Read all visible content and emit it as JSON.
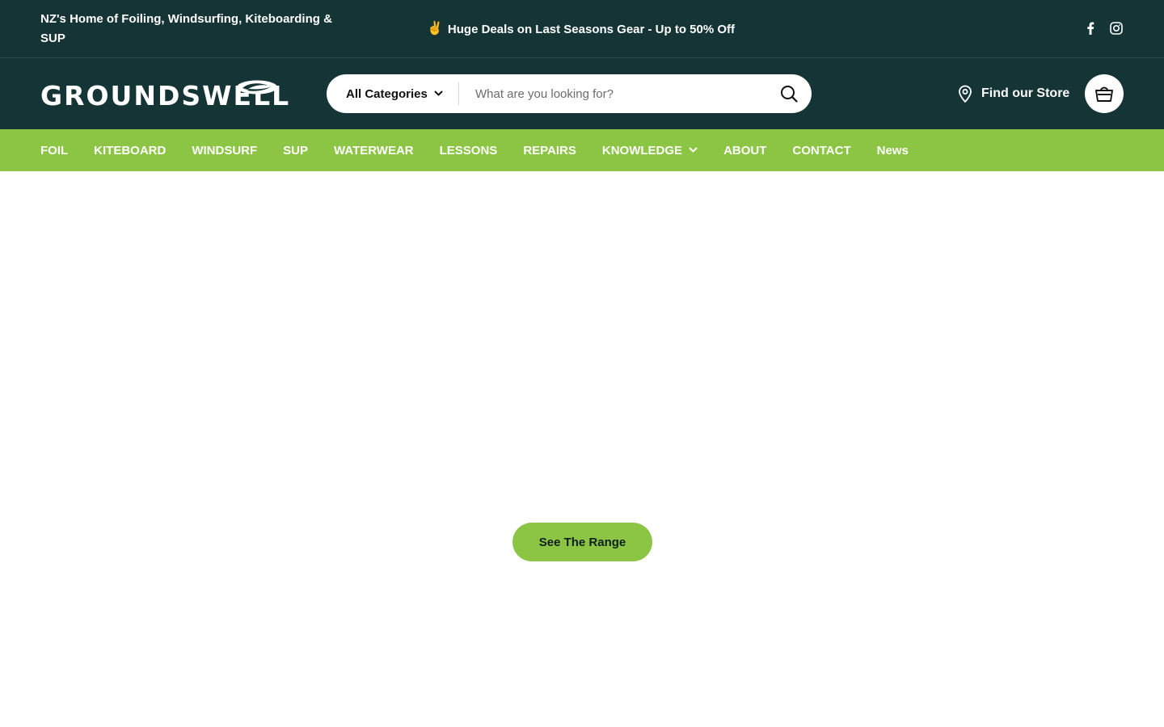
{
  "announcement": {
    "tagline": "NZ's Home of Foiling, Windsurfing, Kiteboarding & SUP",
    "promo_emoji": "✌️",
    "promo_text": "Huge Deals on Last Seasons Gear - Up to 50% Off",
    "social": [
      {
        "icon": "facebook-icon"
      },
      {
        "icon": "instagram-icon"
      }
    ]
  },
  "header": {
    "logo_text": "GROUNDSWELL",
    "search": {
      "category_label": "All Categories",
      "placeholder": "What are you looking for?",
      "value": ""
    },
    "find_store_label": "Find our Store",
    "cart_icon": "shopping-bag-icon"
  },
  "nav": {
    "items": [
      {
        "label": "FOIL"
      },
      {
        "label": "KITEBOARD"
      },
      {
        "label": "WINDSURF"
      },
      {
        "label": "SUP"
      },
      {
        "label": "WATERWEAR"
      },
      {
        "label": "LESSONS"
      },
      {
        "label": "REPAIRS"
      },
      {
        "label": "KNOWLEDGE"
      },
      {
        "label": "ABOUT"
      },
      {
        "label": "CONTACT"
      },
      {
        "label": "News"
      }
    ]
  },
  "hero": {
    "cta_label": "See The Range"
  },
  "colors": {
    "header_bg": "#143436",
    "nav_bg": "#8bc543",
    "cta_bg": "#8bc543",
    "text_light": "#ffffff"
  }
}
